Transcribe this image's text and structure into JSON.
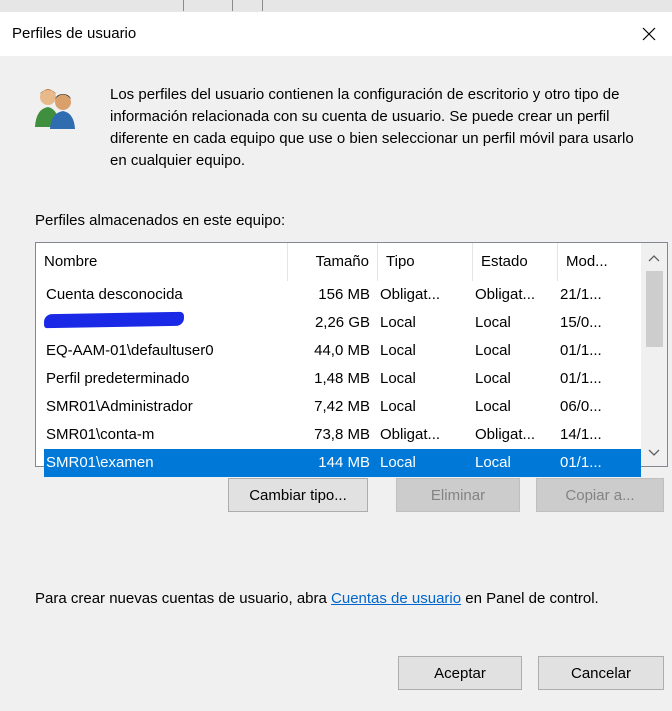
{
  "dialog": {
    "title": "Perfiles de usuario",
    "description": "Los perfiles del usuario contienen la configuración de escritorio y otro tipo de información relacionada con su cuenta de usuario. Se puede crear un perfil diferente en cada equipo que use o bien seleccionar un perfil móvil para usarlo en cualquier equipo.",
    "profiles_label": "Perfiles almacenados en este equipo:"
  },
  "table": {
    "columns": [
      "Nombre",
      "Tamaño",
      "Tipo",
      "Estado",
      "Mod..."
    ],
    "rows": [
      {
        "nombre": "Cuenta desconocida",
        "tamano": "156 MB",
        "tipo": "Obligat...",
        "estado": "Obligat...",
        "mod": "21/1..."
      },
      {
        "nombre": "",
        "tamano": "2,26 GB",
        "tipo": "Local",
        "estado": "Local",
        "mod": "15/0..."
      },
      {
        "nombre": "EQ-AAM-01\\defaultuser0",
        "tamano": "44,0 MB",
        "tipo": "Local",
        "estado": "Local",
        "mod": "01/1..."
      },
      {
        "nombre": "Perfil predeterminado",
        "tamano": "1,48 MB",
        "tipo": "Local",
        "estado": "Local",
        "mod": "01/1..."
      },
      {
        "nombre": "SMR01\\Administrador",
        "tamano": "7,42 MB",
        "tipo": "Local",
        "estado": "Local",
        "mod": "06/0..."
      },
      {
        "nombre": "SMR01\\conta-m",
        "tamano": "73,8 MB",
        "tipo": "Obligat...",
        "estado": "Obligat...",
        "mod": "14/1..."
      },
      {
        "nombre": "SMR01\\examen",
        "tamano": "144 MB",
        "tipo": "Local",
        "estado": "Local",
        "mod": "01/1..."
      }
    ],
    "selected_row": 6
  },
  "buttons": {
    "cambiar_tipo": "Cambiar tipo...",
    "eliminar": "Eliminar",
    "copiar": "Copiar a...",
    "aceptar": "Aceptar",
    "cancelar": "Cancelar"
  },
  "help": {
    "before": "Para crear nuevas cuentas de usuario, abra ",
    "link": "Cuentas de usuario",
    "after": " en Panel de control."
  },
  "colors": {
    "selection": "#0078d7",
    "link": "#0066cc",
    "redaction": "#1a29e6"
  }
}
